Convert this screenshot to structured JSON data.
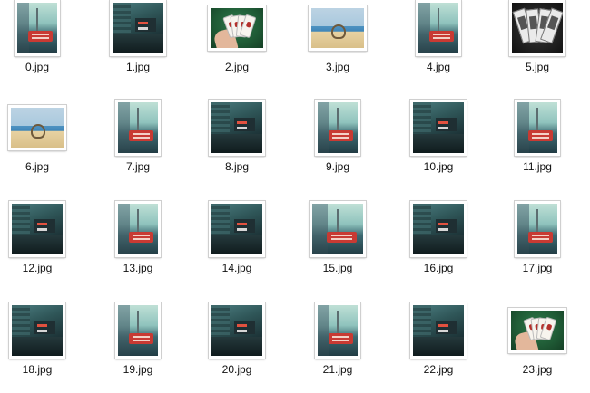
{
  "files": [
    {
      "name": "0.jpg",
      "image": "sky-portrait"
    },
    {
      "name": "1.jpg",
      "image": "city-square"
    },
    {
      "name": "2.jpg",
      "image": "cards-landscape"
    },
    {
      "name": "3.jpg",
      "image": "beach-landscape"
    },
    {
      "name": "4.jpg",
      "image": "sky-portrait"
    },
    {
      "name": "5.jpg",
      "image": "bw-cards"
    },
    {
      "name": "6.jpg",
      "image": "beach-landscape"
    },
    {
      "name": "7.jpg",
      "image": "sky-portrait"
    },
    {
      "name": "8.jpg",
      "image": "city-square"
    },
    {
      "name": "9.jpg",
      "image": "sky-portrait"
    },
    {
      "name": "10.jpg",
      "image": "city-square"
    },
    {
      "name": "11.jpg",
      "image": "sky-portrait"
    },
    {
      "name": "12.jpg",
      "image": "city-square"
    },
    {
      "name": "13.jpg",
      "image": "sky-portrait"
    },
    {
      "name": "14.jpg",
      "image": "city-square"
    },
    {
      "name": "15.jpg",
      "image": "sky-square"
    },
    {
      "name": "16.jpg",
      "image": "city-square"
    },
    {
      "name": "17.jpg",
      "image": "sky-portrait"
    },
    {
      "name": "18.jpg",
      "image": "city-square"
    },
    {
      "name": "19.jpg",
      "image": "sky-portrait"
    },
    {
      "name": "20.jpg",
      "image": "city-square"
    },
    {
      "name": "21.jpg",
      "image": "sky-portrait"
    },
    {
      "name": "22.jpg",
      "image": "city-square"
    },
    {
      "name": "23.jpg",
      "image": "cards-landscape"
    }
  ]
}
